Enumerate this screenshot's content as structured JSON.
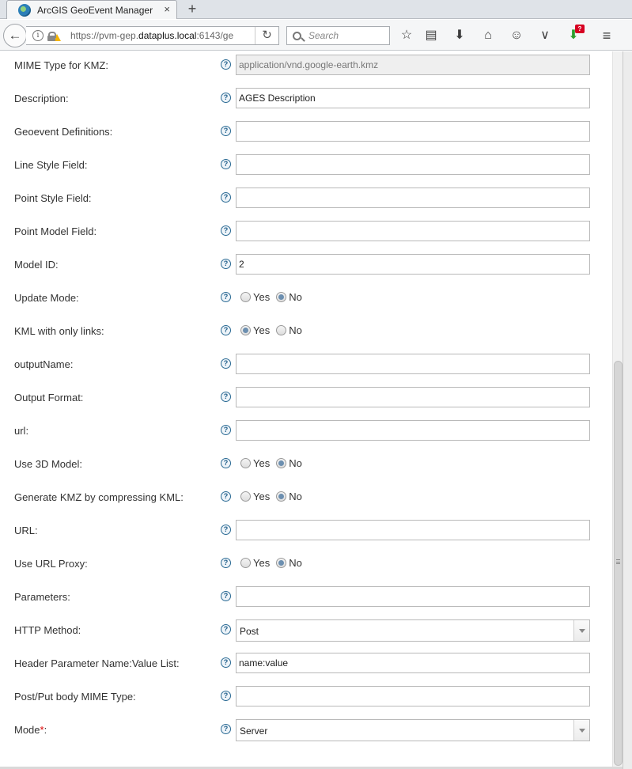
{
  "browser": {
    "tab_title": "ArcGIS GeoEvent Manager",
    "tab_close": "×",
    "new_tab": "+",
    "url_prefix": "https://pvm-gep.",
    "url_domain": "dataplus.local",
    "url_suffix": ":6143/ge",
    "search_placeholder": "Search",
    "download_badge": "?",
    "icons": [
      "back-arrow-icon",
      "info-icon",
      "lock-icon",
      "warning-icon",
      "reload-icon",
      "search-icon",
      "bookmark-star-icon",
      "reading-list-icon",
      "download-icon",
      "home-icon",
      "chat-icon",
      "pocket-icon",
      "downloads-addon-icon",
      "hamburger-menu-icon"
    ]
  },
  "form": {
    "help_glyph": "?",
    "fields": [
      {
        "label": "MIME Type for KMZ:",
        "type": "text",
        "value": "application/vnd.google-earth.kmz",
        "disabled": true
      },
      {
        "label": "Description:",
        "type": "text",
        "value": "AGES Description"
      },
      {
        "label": "Geoevent Definitions:",
        "type": "text",
        "value": ""
      },
      {
        "label": "Line Style Field:",
        "type": "text",
        "value": ""
      },
      {
        "label": "Point Style Field:",
        "type": "text",
        "value": ""
      },
      {
        "label": "Point Model Field:",
        "type": "text",
        "value": ""
      },
      {
        "label": "Model ID:",
        "type": "text",
        "value": "2"
      },
      {
        "label": "Update Mode:",
        "type": "radio",
        "options": [
          "Yes",
          "No"
        ],
        "selected": "No"
      },
      {
        "label": "KML with only links:",
        "type": "radio",
        "options": [
          "Yes",
          "No"
        ],
        "selected": "Yes"
      },
      {
        "label": "outputName:",
        "type": "text",
        "value": ""
      },
      {
        "label": "Output Format:",
        "type": "text",
        "value": ""
      },
      {
        "label": "url:",
        "type": "text",
        "value": ""
      },
      {
        "label": "Use 3D Model:",
        "type": "radio",
        "options": [
          "Yes",
          "No"
        ],
        "selected": "No"
      },
      {
        "label": "Generate KMZ by compressing KML:",
        "type": "radio",
        "options": [
          "Yes",
          "No"
        ],
        "selected": "No"
      },
      {
        "label": "URL:",
        "type": "text",
        "value": ""
      },
      {
        "label": "Use URL Proxy:",
        "type": "radio",
        "options": [
          "Yes",
          "No"
        ],
        "selected": "No"
      },
      {
        "label": "Parameters:",
        "type": "text",
        "value": ""
      },
      {
        "label": "HTTP Method:",
        "type": "select",
        "value": "Post"
      },
      {
        "label": "Header Parameter Name:Value List:",
        "type": "text",
        "value": "name:value"
      },
      {
        "label": "Post/Put body MIME Type:",
        "type": "text",
        "value": ""
      },
      {
        "label": "Mode",
        "required": "*",
        "label_suffix": ":",
        "type": "select",
        "value": "Server"
      }
    ]
  },
  "colors": {
    "required": "#dd0000",
    "help_icon": "#1f5f8b",
    "radio_checked": "#6c8fb0",
    "download_badge": "#d70022"
  }
}
